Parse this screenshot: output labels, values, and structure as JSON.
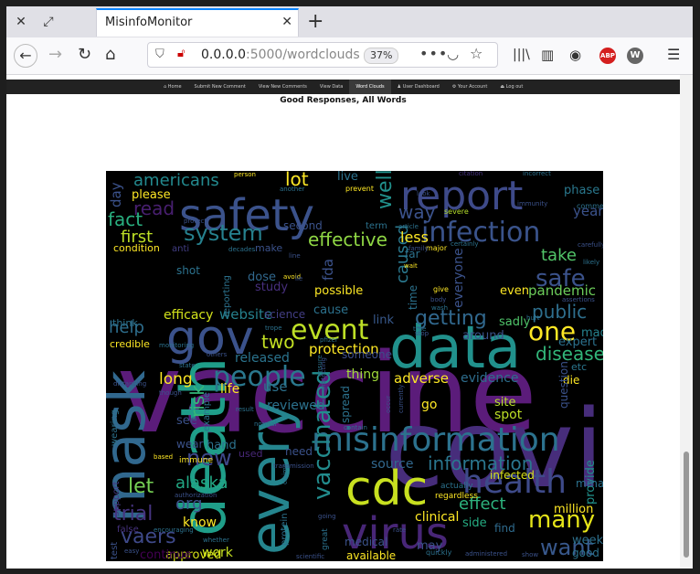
{
  "browser": {
    "tab_title": "MisinfoMonitor",
    "url_host": "0.0.0.0",
    "url_path": ":5000/wordclouds",
    "zoom": "37%",
    "abp_label": "ABP",
    "w_label": "W",
    "accent": "#0a84ff"
  },
  "site_nav": {
    "items": [
      "Home",
      "Submit New Comment",
      "View New Comments",
      "View Data",
      "Word Clouds",
      "User Dashboard",
      "Your Account",
      "Log out"
    ],
    "active": "Word Clouds"
  },
  "page": {
    "heading": "Good Responses, All Words"
  },
  "wordcloud": {
    "words": [
      {
        "t": "vaccine",
        "c": "#5b1c7a"
      },
      {
        "t": "covid",
        "c": "#472d7b"
      },
      {
        "t": "safety",
        "c": "#3b528b"
      },
      {
        "t": "report",
        "c": "#3e4a89"
      },
      {
        "t": "data",
        "c": "#21918c"
      },
      {
        "t": "cdc",
        "c": "#c8e020"
      },
      {
        "t": "death",
        "c": "#1f9e89"
      },
      {
        "t": "every",
        "c": "#25858e"
      },
      {
        "t": "mask",
        "c": "#31688e"
      },
      {
        "t": "gov",
        "c": "#3b528b"
      },
      {
        "t": "virus",
        "c": "#482677"
      },
      {
        "t": "misinformation",
        "c": "#2c728e"
      },
      {
        "t": "health",
        "c": "#3e4a89"
      },
      {
        "t": "infection",
        "c": "#3a538b"
      },
      {
        "t": "event",
        "c": "#bddf26"
      },
      {
        "t": "people",
        "c": "#2a788e"
      },
      {
        "t": "system",
        "c": "#26818e"
      },
      {
        "t": "vaccinated",
        "c": "#228c8d"
      },
      {
        "t": "disease",
        "c": "#32b67a"
      },
      {
        "t": "many",
        "c": "#e5e419"
      },
      {
        "t": "want",
        "c": "#38588c"
      },
      {
        "t": "one",
        "c": "#fde725"
      },
      {
        "t": "safe",
        "c": "#3b528b"
      },
      {
        "t": "information",
        "c": "#2a768e"
      },
      {
        "t": "getting",
        "c": "#31688e"
      },
      {
        "t": "public",
        "c": "#2e6f8e"
      },
      {
        "t": "vaers",
        "c": "#3e4989"
      },
      {
        "t": "effect",
        "c": "#2db27d"
      },
      {
        "t": "two",
        "c": "#c2df23"
      },
      {
        "t": "risk",
        "c": "#35b779"
      },
      {
        "t": "new",
        "c": "#3f4889"
      },
      {
        "t": "americans",
        "c": "#23898e"
      },
      {
        "t": "fact",
        "c": "#29af7f"
      },
      {
        "t": "read",
        "c": "#481f70"
      },
      {
        "t": "lot",
        "c": "#fde725"
      },
      {
        "t": "first",
        "c": "#bddf26"
      },
      {
        "t": "help",
        "c": "#2e6e8e"
      },
      {
        "t": "long",
        "c": "#fde725"
      },
      {
        "t": "take",
        "c": "#52c569"
      },
      {
        "t": "pandemic",
        "c": "#6ccd5a"
      },
      {
        "t": "alaska",
        "c": "#22a884"
      },
      {
        "t": "trial",
        "c": "#46337f"
      },
      {
        "t": "org",
        "c": "#3b528b"
      },
      {
        "t": "let",
        "c": "#75d054"
      },
      {
        "t": "effective",
        "c": "#8fd744"
      },
      {
        "t": "way",
        "c": "#3b528b"
      },
      {
        "t": "clinical",
        "c": "#fde725"
      },
      {
        "t": "spot",
        "c": "#bddf26"
      },
      {
        "t": "adverse",
        "c": "#fde725"
      },
      {
        "t": "evidence",
        "c": "#2e6e8e"
      },
      {
        "t": "released",
        "c": "#2b748e"
      },
      {
        "t": "protection",
        "c": "#fde725"
      },
      {
        "t": "reviewed",
        "c": "#2c728e"
      },
      {
        "t": "caused",
        "c": "#2a788e"
      },
      {
        "t": "efficacy",
        "c": "#d2e21b"
      },
      {
        "t": "website",
        "c": "#26818e"
      },
      {
        "t": "work",
        "c": "#c5e021"
      },
      {
        "t": "approved",
        "c": "#d8e219"
      },
      {
        "t": "continue",
        "c": "#440154"
      },
      {
        "t": "know",
        "c": "#fde725"
      },
      {
        "t": "phase",
        "c": "#2a788e"
      },
      {
        "t": "year",
        "c": "#3b528b"
      },
      {
        "t": "well",
        "c": "#21918c"
      },
      {
        "t": "less",
        "c": "#fde725"
      },
      {
        "t": "shot",
        "c": "#2c728e"
      },
      {
        "t": "dose",
        "c": "#31688e"
      },
      {
        "t": "study",
        "c": "#472f7d"
      },
      {
        "t": "possible",
        "c": "#fde725"
      },
      {
        "t": "cause",
        "c": "#2c728e"
      },
      {
        "t": "science",
        "c": "#433e85"
      },
      {
        "t": "use",
        "c": "#2c728e"
      },
      {
        "t": "life",
        "c": "#fde725"
      },
      {
        "t": "thing",
        "c": "#a0da39"
      },
      {
        "t": "link",
        "c": "#38598c"
      },
      {
        "t": "made",
        "c": "#26828e"
      },
      {
        "t": "expert",
        "c": "#2c728e"
      },
      {
        "t": "die",
        "c": "#fde725"
      },
      {
        "t": "etc",
        "c": "#2a778e"
      },
      {
        "t": "even",
        "c": "#fde725"
      },
      {
        "t": "sadly",
        "c": "#4fc46a"
      },
      {
        "t": "around",
        "c": "#3b528b"
      },
      {
        "t": "someone",
        "c": "#3d4d8a"
      },
      {
        "t": "source",
        "c": "#31688e"
      },
      {
        "t": "infected",
        "c": "#d8e219"
      },
      {
        "t": "side",
        "c": "#25ac82"
      },
      {
        "t": "find",
        "c": "#2f6b8e"
      },
      {
        "t": "million",
        "c": "#fde725"
      },
      {
        "t": "provide",
        "c": "#21918c"
      },
      {
        "t": "mrna",
        "c": "#2c728e"
      },
      {
        "t": "week",
        "c": "#2d708e"
      },
      {
        "t": "good",
        "c": "#2c728e"
      },
      {
        "t": "may",
        "c": "#3b528b"
      },
      {
        "t": "available",
        "c": "#fde725"
      },
      {
        "t": "false",
        "c": "#46327e"
      },
      {
        "t": "support",
        "c": "#443983"
      },
      {
        "t": "wearing",
        "c": "#2c728e"
      },
      {
        "t": "condition",
        "c": "#fde725"
      },
      {
        "t": "anti",
        "c": "#433e85"
      },
      {
        "t": "make",
        "c": "#3b528b"
      },
      {
        "t": "second",
        "c": "#3b528b"
      },
      {
        "t": "term",
        "c": "#2c728e"
      },
      {
        "t": "see",
        "c": "#3b528b"
      },
      {
        "t": "wear",
        "c": "#3b528b"
      },
      {
        "t": "hand",
        "c": "#2c728e"
      },
      {
        "t": "credible",
        "c": "#fde725"
      },
      {
        "t": "think",
        "c": "#2c728e"
      },
      {
        "t": "need",
        "c": "#3b528b"
      },
      {
        "t": "used",
        "c": "#482878"
      },
      {
        "t": "go",
        "c": "#fde725"
      },
      {
        "t": "site",
        "c": "#b5de2b"
      },
      {
        "t": "question",
        "c": "#3b528b"
      },
      {
        "t": "spread",
        "c": "#2c728e"
      },
      {
        "t": "please",
        "c": "#fde725"
      },
      {
        "t": "day",
        "c": "#3b528b"
      },
      {
        "t": "live",
        "c": "#2c728e"
      },
      {
        "t": "fda",
        "c": "#3b528b"
      },
      {
        "t": "everyone",
        "c": "#3b528b"
      },
      {
        "t": "time",
        "c": "#2c728e"
      },
      {
        "t": "far",
        "c": "#2c728e"
      },
      {
        "t": "test",
        "c": "#3b528b"
      },
      {
        "t": "example",
        "c": "#2c728e"
      },
      {
        "t": "reporting",
        "c": "#2c728e"
      },
      {
        "t": "immune",
        "c": "#fde725"
      },
      {
        "t": "based",
        "c": "#fde725"
      },
      {
        "t": "protein",
        "c": "#2c728e"
      },
      {
        "t": "medical",
        "c": "#3b528b"
      },
      {
        "t": "actually",
        "c": "#2c728e"
      },
      {
        "t": "regardless",
        "c": "#fde725"
      },
      {
        "t": "person",
        "c": "#fde725"
      },
      {
        "t": "another",
        "c": "#2c728e"
      },
      {
        "t": "prevent",
        "c": "#fde725"
      },
      {
        "t": "citation",
        "c": "#46327e"
      },
      {
        "t": "incorrect",
        "c": "#2c728e"
      },
      {
        "t": "look",
        "c": "#3b528b"
      },
      {
        "t": "severe",
        "c": "#b5de2b"
      },
      {
        "t": "comments",
        "c": "#2c728e"
      },
      {
        "t": "immunity",
        "c": "#3b528b"
      },
      {
        "t": "article",
        "c": "#2c728e"
      },
      {
        "t": "carefully",
        "c": "#3b528b"
      },
      {
        "t": "major",
        "c": "#fde725"
      },
      {
        "t": "certainly",
        "c": "#2c728e"
      },
      {
        "t": "family",
        "c": "#3b528b"
      },
      {
        "t": "likely",
        "c": "#2c728e"
      },
      {
        "t": "wait",
        "c": "#fde725"
      },
      {
        "t": "give",
        "c": "#fde725"
      },
      {
        "t": "body",
        "c": "#3b528b"
      },
      {
        "t": "wash",
        "c": "#2c728e"
      },
      {
        "t": "assertions",
        "c": "#3b528b"
      },
      {
        "t": "true",
        "c": "#2c728e"
      },
      {
        "t": "stop",
        "c": "#3b528b"
      },
      {
        "t": "hurt",
        "c": "#2c728e"
      },
      {
        "t": "avoid",
        "c": "#fde725"
      },
      {
        "t": "line",
        "c": "#3b528b"
      },
      {
        "t": "trope",
        "c": "#2c728e"
      },
      {
        "t": "decades",
        "c": "#2c728e"
      },
      {
        "t": "protect",
        "c": "#3b528b"
      },
      {
        "t": "pfizer",
        "c": "#2c728e"
      },
      {
        "t": "monitoring",
        "c": "#2c728e"
      },
      {
        "t": "others",
        "c": "#3b528b"
      },
      {
        "t": "though",
        "c": "#3b528b"
      },
      {
        "t": "distancing",
        "c": "#3b528b"
      },
      {
        "t": "state",
        "c": "#2c728e"
      },
      {
        "t": "normal",
        "c": "#2c728e"
      },
      {
        "t": "result",
        "c": "#2c728e"
      },
      {
        "t": "claims",
        "c": "#2c728e"
      },
      {
        "t": "transmission",
        "c": "#3b528b"
      },
      {
        "t": "encouraging",
        "c": "#2c728e"
      },
      {
        "t": "authorization",
        "c": "#3b528b"
      },
      {
        "t": "whether",
        "c": "#2c728e"
      },
      {
        "t": "easy",
        "c": "#3b528b"
      },
      {
        "t": "scientific",
        "c": "#3b528b"
      },
      {
        "t": "great",
        "c": "#2c728e"
      },
      {
        "t": "quickly",
        "c": "#2c728e"
      },
      {
        "t": "administered",
        "c": "#3b528b"
      },
      {
        "t": "show",
        "c": "#3b528b"
      },
      {
        "t": "going",
        "c": "#3b528b"
      },
      {
        "t": "currently",
        "c": "#3b528b"
      },
      {
        "t": "contain",
        "c": "#2c728e"
      },
      {
        "t": "occur",
        "c": "#3b528b"
      },
      {
        "t": "protecting",
        "c": "#3b528b"
      },
      {
        "t": "rate",
        "c": "#3b528b"
      },
      {
        "t": "ensure",
        "c": "#2c728e"
      },
      {
        "t": "lie",
        "c": "#3b528b"
      }
    ]
  }
}
